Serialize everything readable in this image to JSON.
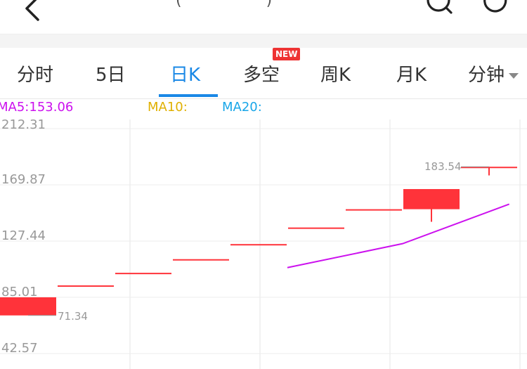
{
  "header": {
    "title_fragment": "(",
    "title_fragment_end": ")"
  },
  "tabs": [
    {
      "label": "分时",
      "active": false
    },
    {
      "label": "5日",
      "active": false
    },
    {
      "label": "日K",
      "active": true
    },
    {
      "label": "多空",
      "active": false,
      "badge": "NEW"
    },
    {
      "label": "周K",
      "active": false
    },
    {
      "label": "月K",
      "active": false
    },
    {
      "label": "分钟",
      "active": false,
      "dropdown": true
    }
  ],
  "indicators": {
    "ma5": "MA5:153.06",
    "ma10": "MA10:",
    "ma20": "MA20:"
  },
  "colors": {
    "accent": "#1a88e6",
    "up": "#ff333a",
    "ma5": "#cc11ee",
    "ma10": "#e0b000",
    "ma20": "#18a6e8",
    "badge": "#e33333"
  },
  "chart_data": {
    "type": "candlestick",
    "y_ticks": [
      "212.31",
      "169.87",
      "127.44",
      "85.01",
      "42.57"
    ],
    "ylim": [
      42.57,
      212.31
    ],
    "grid": true,
    "candles": [
      {
        "open": 71.34,
        "close": 85.01,
        "high": 85.01,
        "low": 71.34
      },
      {
        "open": 94.0,
        "close": 94.0,
        "high": 94.0,
        "low": 94.0
      },
      {
        "open": 103.5,
        "close": 103.5,
        "high": 103.5,
        "low": 103.5
      },
      {
        "open": 113.8,
        "close": 113.8,
        "high": 113.8,
        "low": 113.8
      },
      {
        "open": 125.2,
        "close": 125.2,
        "high": 125.2,
        "low": 125.2
      },
      {
        "open": 137.7,
        "close": 137.7,
        "high": 137.7,
        "low": 137.7
      },
      {
        "open": 151.5,
        "close": 151.5,
        "high": 151.5,
        "low": 151.5
      },
      {
        "open": 151.5,
        "close": 166.7,
        "high": 166.7,
        "low": 142.0
      },
      {
        "open": 183.54,
        "close": 183.54,
        "high": 183.54,
        "low": 177.0
      }
    ],
    "ma5_line": [
      {
        "candle_index": 4.5,
        "value": 107.4
      },
      {
        "candle_index": 6.5,
        "value": 125.5
      },
      {
        "candle_index": 8.35,
        "value": 155.3
      }
    ],
    "annotations": [
      {
        "text": "183.54",
        "candle_index": 8,
        "value": 183.54
      },
      {
        "text": "71.34",
        "candle_index": 0,
        "value": 71.34
      }
    ]
  }
}
